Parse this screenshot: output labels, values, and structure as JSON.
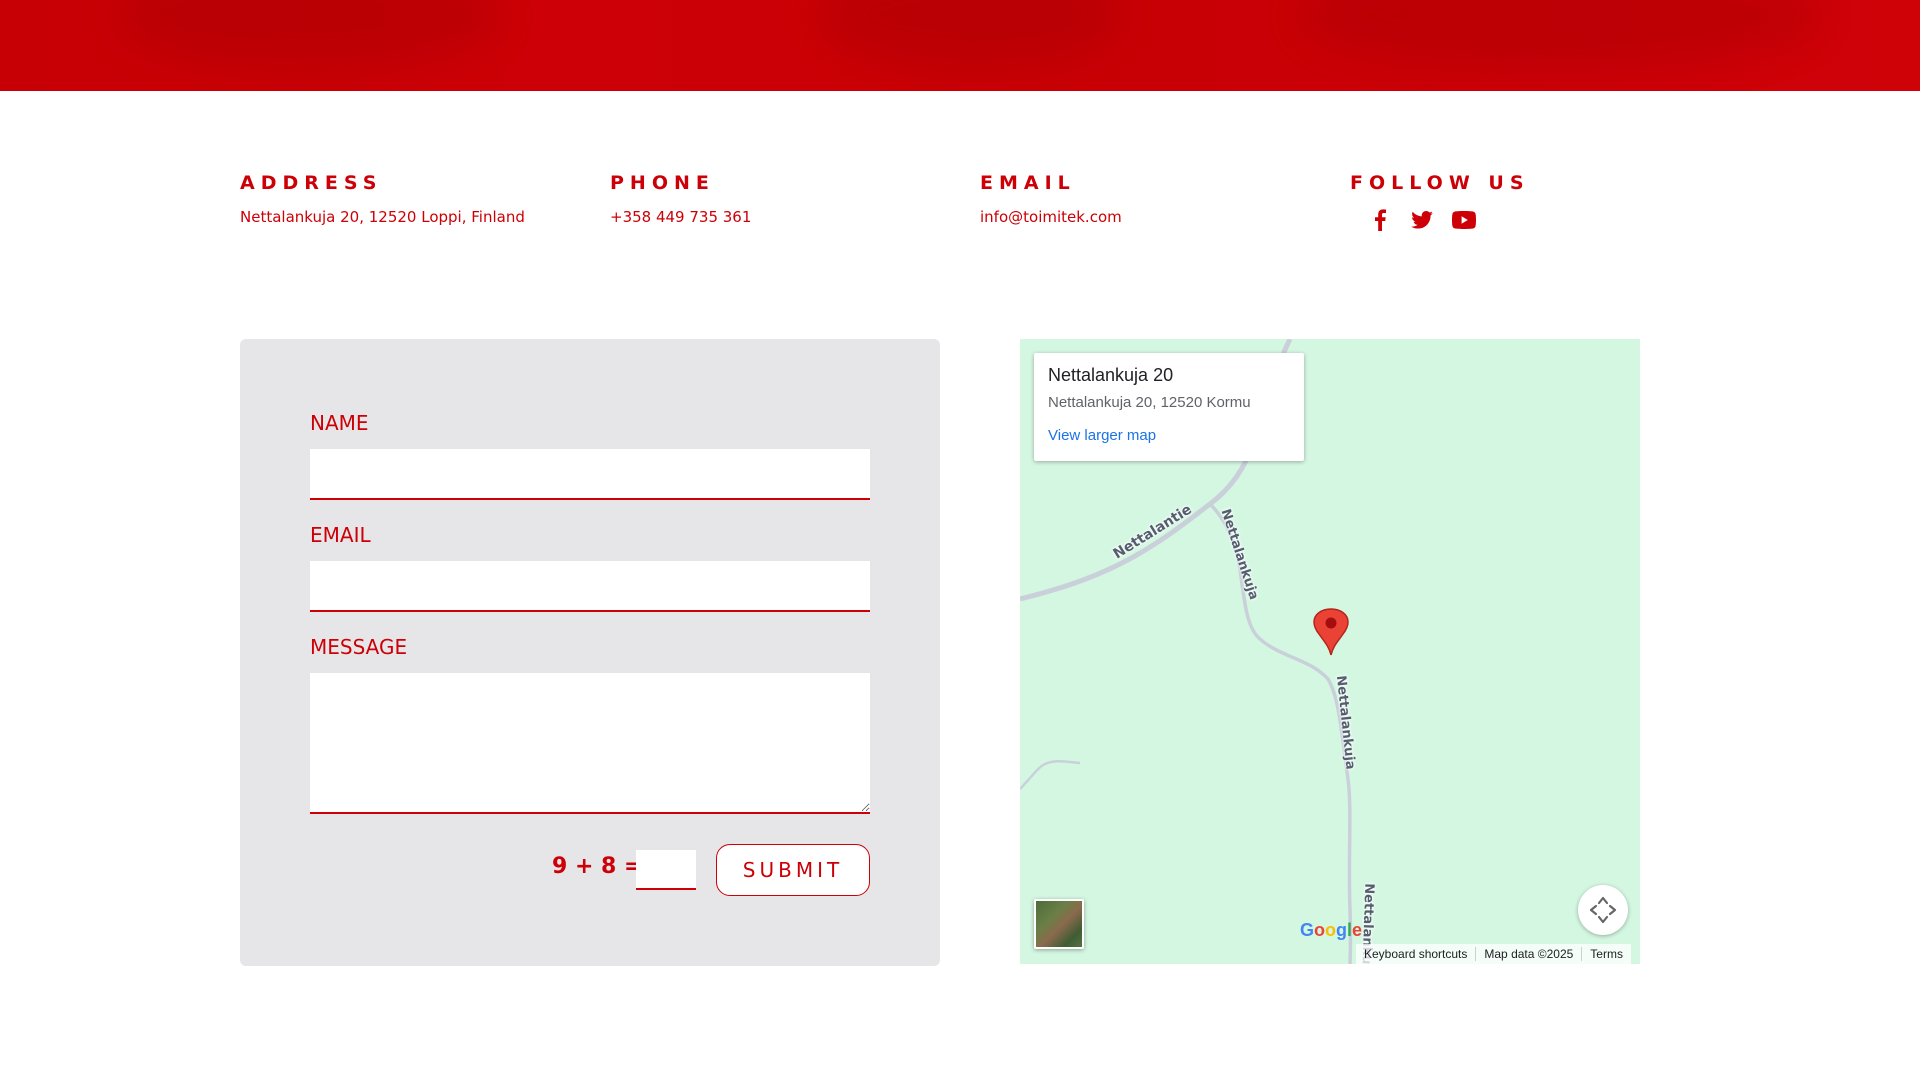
{
  "colors": {
    "brand_red": "#cc0006",
    "form_bg": "#e6e6e9",
    "map_bg": "#d4f7e2",
    "link_blue": "#1a73e8"
  },
  "contact": {
    "address": {
      "heading": "ADDRESS",
      "value": "Nettalankuja 20, 12520 Loppi, Finland"
    },
    "phone": {
      "heading": "PHONE",
      "value": "+358 449 735 361"
    },
    "email": {
      "heading": "EMAIL",
      "value": "info@toimitek.com"
    },
    "follow": {
      "heading": "FOLLOW US",
      "icons": [
        "facebook-icon",
        "twitter-icon",
        "youtube-icon"
      ]
    }
  },
  "form": {
    "name_label": "NAME",
    "name_value": "",
    "email_label": "EMAIL",
    "email_value": "",
    "message_label": "MESSAGE",
    "message_value": "",
    "captcha_question": "9 + 8 =",
    "captcha_value": "",
    "submit_label": "SUBMIT"
  },
  "map": {
    "card_title": "Nettalankuja 20",
    "card_address": "Nettalankuja 20, 12520 Kormu",
    "card_link": "View larger map",
    "roads": [
      "Nettalantie",
      "Nettalankuja",
      "Nettalankuja",
      "Nettalankuja"
    ],
    "google_logo": "Google",
    "attribution": [
      "Keyboard shortcuts",
      "Map data ©2025",
      "Terms"
    ],
    "icons": [
      "map-pin-icon",
      "fullscreen-icon",
      "satellite-layer-icon"
    ]
  }
}
